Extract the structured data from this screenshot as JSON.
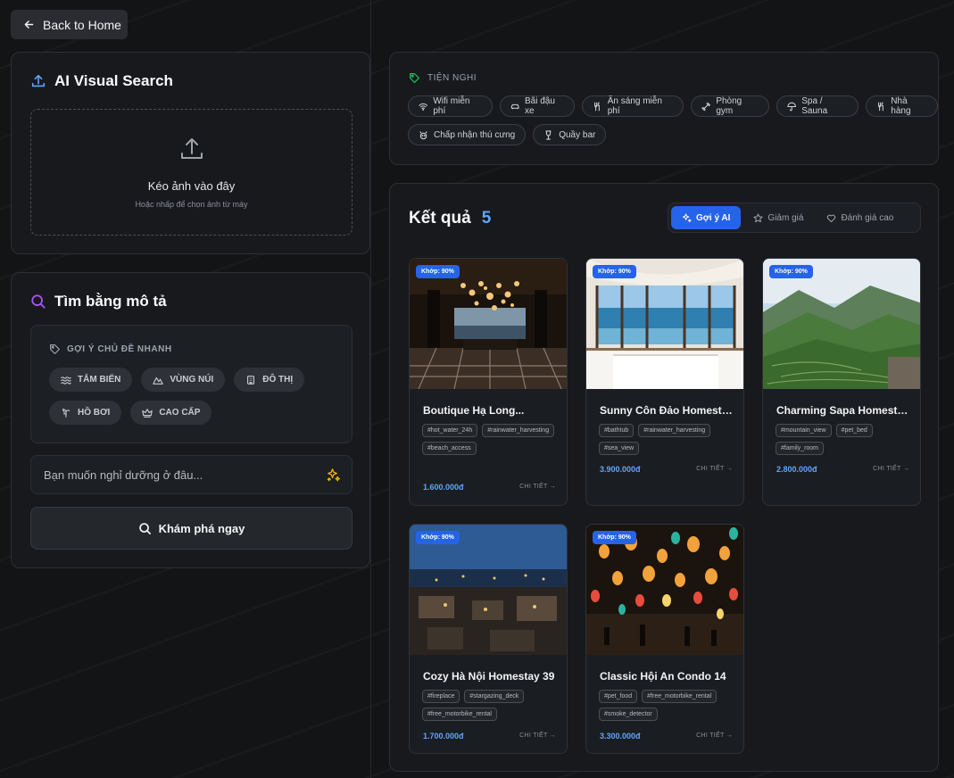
{
  "nav": {
    "back_label": "Back to Home"
  },
  "visual_search": {
    "title": "AI Visual Search",
    "drop_title": "Kéo ảnh vào đây",
    "drop_subtitle": "Hoặc nhấp để chọn ảnh từ máy"
  },
  "describe_search": {
    "title": "Tìm bằng mô tả",
    "suggest_heading": "GỢI Ý CHỦ ĐỀ NHANH",
    "topics": [
      {
        "label": "TẮM BIỂN",
        "icon": "waves-icon"
      },
      {
        "label": "VÙNG NÚI",
        "icon": "mountain-icon"
      },
      {
        "label": "ĐÔ THỊ",
        "icon": "building-icon"
      },
      {
        "label": "HỒ BƠI",
        "icon": "pool-icon"
      },
      {
        "label": "CAO CẤP",
        "icon": "crown-icon"
      }
    ],
    "input_placeholder": "Bạn muốn nghỉ dưỡng ở đâu...",
    "input_value": "",
    "explore_label": "Khám phá ngay"
  },
  "amenities": {
    "heading": "TIỆN NGHI",
    "items": [
      {
        "label": "Wifi miễn phí",
        "icon": "wifi-icon"
      },
      {
        "label": "Bãi đậu xe",
        "icon": "car-icon"
      },
      {
        "label": "Ăn sáng miễn phí",
        "icon": "utensils-icon"
      },
      {
        "label": "Phòng gym",
        "icon": "dumbbell-icon"
      },
      {
        "label": "Spa / Sauna",
        "icon": "umbrella-icon"
      },
      {
        "label": "Nhà hàng",
        "icon": "utensils-icon"
      },
      {
        "label": "Chấp nhận thú cưng",
        "icon": "pet-icon"
      },
      {
        "label": "Quầy bar",
        "icon": "wine-icon"
      }
    ]
  },
  "results": {
    "title": "Kết quả",
    "count": "5",
    "sort": [
      {
        "label": "Gợi ý AI",
        "icon": "sparkles-icon",
        "active": true
      },
      {
        "label": "Giảm giá",
        "icon": "star-icon",
        "active": false
      },
      {
        "label": "Đánh giá cao",
        "icon": "heart-icon",
        "active": false
      }
    ],
    "match_label": "Khớp: 90%",
    "detail_label": "CHI TIẾT →",
    "cards": [
      {
        "name": "Boutique Hạ Long...",
        "tags": [
          "#hot_water_24h",
          "#rainwater_harvesting",
          "#beach_access"
        ],
        "price": "1.600.000đ"
      },
      {
        "name": "Sunny Côn Đảo Homesta...",
        "tags": [
          "#bathtub",
          "#rainwater_harvesting",
          "#sea_view"
        ],
        "price": "3.900.000đ"
      },
      {
        "name": "Charming Sapa Homesta...",
        "tags": [
          "#mountain_view",
          "#pet_bed",
          "#family_room"
        ],
        "price": "2.800.000đ"
      },
      {
        "name": "Cozy Hà Nội Homestay 39",
        "tags": [
          "#fireplace",
          "#stargazing_deck",
          "#free_motorbike_rental"
        ],
        "price": "1.700.000đ"
      },
      {
        "name": "Classic Hội An Condo 14",
        "tags": [
          "#pet_food",
          "#free_motorbike_rental",
          "#smoke_detector"
        ],
        "price": "3.300.000đ"
      }
    ]
  },
  "colors": {
    "accent": "#2563eb",
    "price": "#60a5fa",
    "sparkle": "#eab308",
    "search_icon": "#a855f7"
  }
}
